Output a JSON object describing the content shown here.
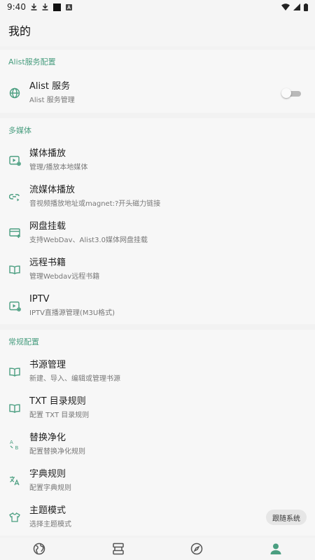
{
  "statusbar": {
    "time": "9:40"
  },
  "header": {
    "title": "我的"
  },
  "sections": [
    {
      "header": "Alist服务配置",
      "items": [
        {
          "title": "Alist 服务",
          "subtitle": "Alist 服务管理",
          "icon": "globe-icon",
          "toggle": false
        }
      ]
    },
    {
      "header": "多媒体",
      "items": [
        {
          "title": "媒体播放",
          "subtitle": "管理/播放本地媒体",
          "icon": "media-settings-icon"
        },
        {
          "title": "流媒体播放",
          "subtitle": "音视频播放地址或magnet:?开头磁力链接",
          "icon": "link-stream-icon"
        },
        {
          "title": "网盘挂载",
          "subtitle": "支持WebDav、Alist3.0媒体网盘挂载",
          "icon": "card-add-icon"
        },
        {
          "title": "远程书籍",
          "subtitle": "管理Webdav远程书籍",
          "icon": "book-open-icon"
        },
        {
          "title": "IPTV",
          "subtitle": "IPTV直播源管理(M3U格式)",
          "icon": "tv-settings-icon"
        }
      ]
    },
    {
      "header": "常规配置",
      "items": [
        {
          "title": "书源管理",
          "subtitle": "新建、导入、编辑或管理书源",
          "icon": "book-open-icon"
        },
        {
          "title": "TXT 目录规则",
          "subtitle": "配置 TXT 目录规则",
          "icon": "book-open-icon"
        },
        {
          "title": "替换净化",
          "subtitle": "配置替换净化规则",
          "icon": "ab-replace-icon"
        },
        {
          "title": "字典规则",
          "subtitle": "配置字典规则",
          "icon": "translate-icon"
        },
        {
          "title": "主题模式",
          "subtitle": "选择主题模式",
          "icon": "tshirt-icon"
        }
      ]
    }
  ],
  "theme_chip": "跟随系统",
  "bottom_nav": [
    {
      "name": "discover",
      "icon": "globe-icon"
    },
    {
      "name": "bookshelf",
      "icon": "bookshelf-icon"
    },
    {
      "name": "explore",
      "icon": "compass-icon"
    },
    {
      "name": "my",
      "icon": "person-icon",
      "active": true
    }
  ],
  "colors": {
    "accent": "#4a9e80",
    "nav_active": "#4a9e80",
    "nav_inactive": "#555555"
  }
}
